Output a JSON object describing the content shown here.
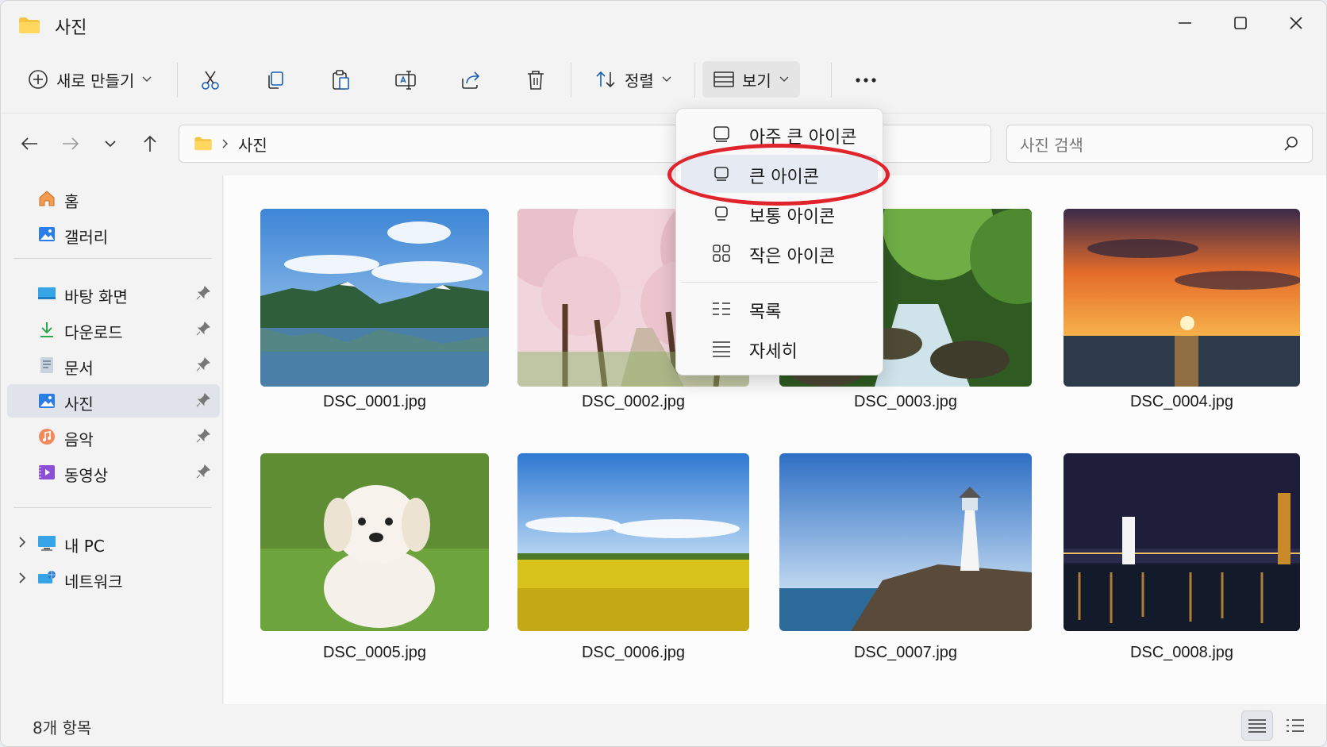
{
  "window": {
    "title": "사진",
    "controls": {
      "minimize": "minimize-icon",
      "maximize": "maximize-icon",
      "close": "close-icon"
    }
  },
  "toolbar": {
    "new_label": "새로 만들기",
    "sort_label": "정렬",
    "view_label": "보기",
    "icons": [
      "cut-icon",
      "copy-icon",
      "paste-icon",
      "rename-icon",
      "share-icon",
      "delete-icon",
      "more-icon"
    ]
  },
  "address": {
    "path": "사진",
    "search_placeholder": "사진 검색"
  },
  "sidebar": {
    "items": [
      {
        "label": "홈",
        "icon": "home-icon"
      },
      {
        "label": "갤러리",
        "icon": "gallery-icon"
      },
      {
        "label": "바탕 화면",
        "icon": "desktop-icon",
        "pinned": true
      },
      {
        "label": "다운로드",
        "icon": "download-icon",
        "pinned": true
      },
      {
        "label": "문서",
        "icon": "documents-icon",
        "pinned": true
      },
      {
        "label": "사진",
        "icon": "pictures-icon",
        "pinned": true,
        "active": true
      },
      {
        "label": "음악",
        "icon": "music-icon",
        "pinned": true
      },
      {
        "label": "동영상",
        "icon": "videos-icon",
        "pinned": true
      },
      {
        "label": "내 PC",
        "icon": "this-pc-icon"
      },
      {
        "label": "네트워크",
        "icon": "network-icon"
      }
    ]
  },
  "files": [
    {
      "name": "DSC_0001.jpg"
    },
    {
      "name": "DSC_0002.jpg"
    },
    {
      "name": "DSC_0003.jpg"
    },
    {
      "name": "DSC_0004.jpg"
    },
    {
      "name": "DSC_0005.jpg"
    },
    {
      "name": "DSC_0006.jpg"
    },
    {
      "name": "DSC_0007.jpg"
    },
    {
      "name": "DSC_0008.jpg"
    }
  ],
  "view_menu": {
    "items": [
      {
        "label": "아주 큰 아이콘",
        "icon": "extra-large-icons-icon"
      },
      {
        "label": "큰 아이콘",
        "icon": "large-icons-icon",
        "selected": true
      },
      {
        "label": "보통 아이콘",
        "icon": "medium-icons-icon"
      },
      {
        "label": "작은 아이콘",
        "icon": "small-icons-icon"
      },
      {
        "label": "목록",
        "icon": "list-icon"
      },
      {
        "label": "자세히",
        "icon": "details-icon"
      }
    ]
  },
  "status": {
    "count_label": "8개 항목"
  },
  "colors": {
    "accent": "#0067c0",
    "highlight": "#e0242b"
  }
}
